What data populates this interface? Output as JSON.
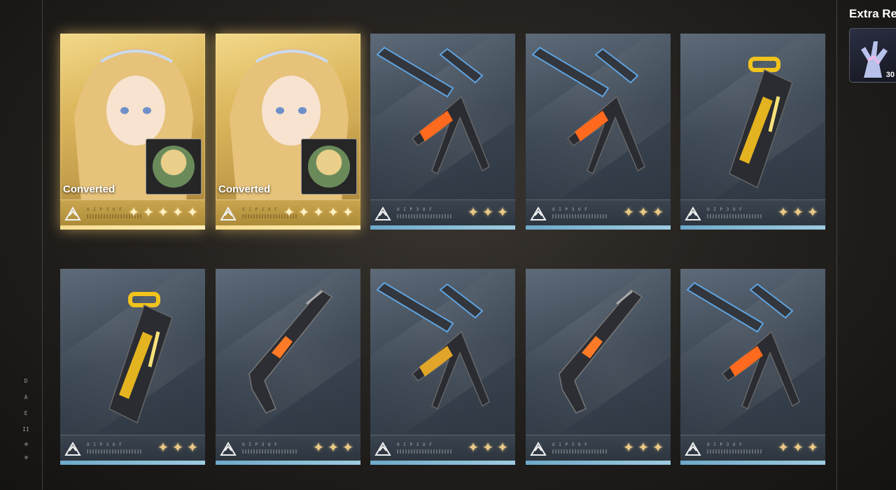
{
  "extra_rewards": {
    "title": "Extra Re",
    "item": {
      "icon": "coral-crystal-icon",
      "count": "30"
    }
  },
  "cards": [
    {
      "kind": "character",
      "label": "Converted",
      "code": "O I P 3 O F",
      "stars": 5,
      "type_icon": "wings-emblem-icon"
    },
    {
      "kind": "character",
      "label": "Converted",
      "code": "O I P 3 O F",
      "stars": 5,
      "type_icon": "wings-emblem-icon"
    },
    {
      "kind": "weapon",
      "weapon": "crossbow",
      "code": "O I P 3 O F",
      "stars": 3,
      "type_icon": "crossbow-type-icon"
    },
    {
      "kind": "weapon",
      "weapon": "crossbow",
      "code": "O I P 3 O F",
      "stars": 3,
      "type_icon": "crossbow-type-icon"
    },
    {
      "kind": "weapon",
      "weapon": "launcher",
      "code": "O I P 3 O F",
      "stars": 3,
      "type_icon": "launcher-type-icon"
    },
    {
      "kind": "weapon",
      "weapon": "launcher",
      "code": "O I P 3 O F",
      "stars": 3,
      "type_icon": "launcher-type-icon"
    },
    {
      "kind": "weapon",
      "weapon": "pistol",
      "code": "O I P 3 O F",
      "stars": 3,
      "type_icon": "pistol-type-icon"
    },
    {
      "kind": "weapon",
      "weapon": "crossbow-gold",
      "code": "O I P 3 O F",
      "stars": 3,
      "type_icon": "crossbow-type-icon"
    },
    {
      "kind": "weapon",
      "weapon": "pistol",
      "code": "O I P 3 O F",
      "stars": 3,
      "type_icon": "pistol-type-icon"
    },
    {
      "kind": "weapon",
      "weapon": "crossbow",
      "code": "O I P 3 O F",
      "stars": 3,
      "type_icon": "crossbow-type-icon"
    }
  ],
  "side_rail": [
    "D",
    "A",
    "E",
    "II"
  ],
  "colors": {
    "gold": "#e9c986",
    "card_gold": "#d8b155",
    "card_steel": "#3b4653",
    "accent_blue": "#6ea9c9"
  }
}
